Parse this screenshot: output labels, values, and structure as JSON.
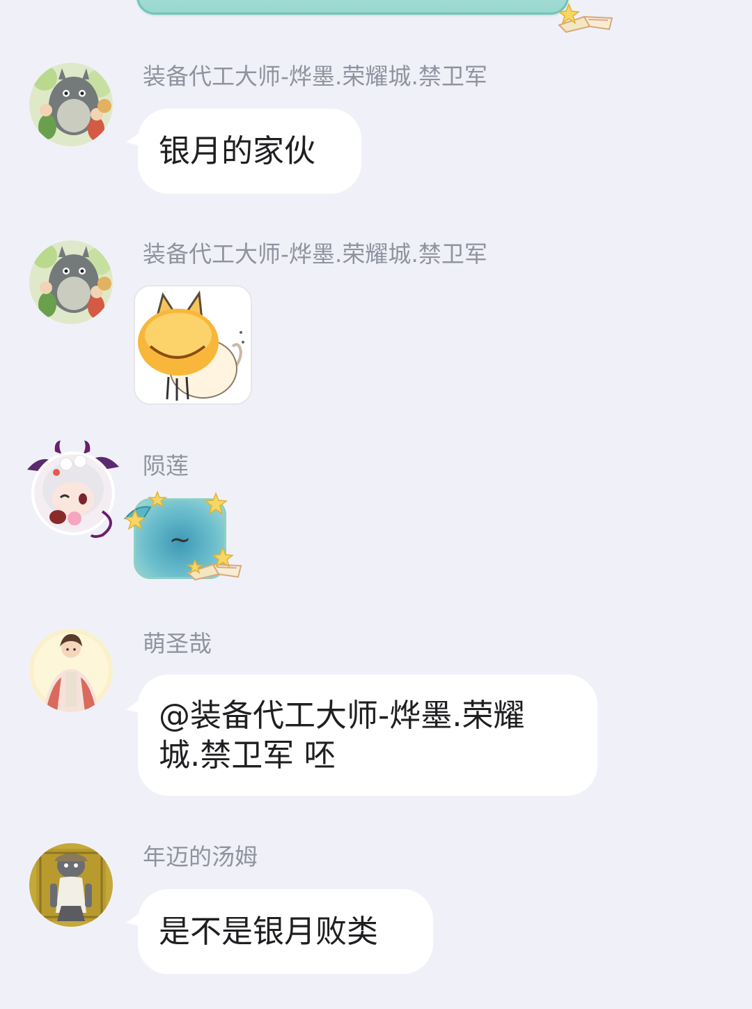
{
  "messages": [
    {
      "sender": "装备代工大师-烨墨.荣耀城.禁卫军",
      "type": "text",
      "text": "银月的家伙",
      "avatar_icon": "totoro-avatar-icon"
    },
    {
      "sender": "装备代工大师-烨墨.荣耀城.禁卫军",
      "type": "sticker",
      "sticker_icon": "yellow-cat-sticker-icon",
      "avatar_icon": "totoro-avatar-icon"
    },
    {
      "sender": "陨莲",
      "type": "text",
      "text": "~",
      "bubble_theme": "teal-star-book",
      "avatar_icon": "demon-wing-anime-avatar-icon"
    },
    {
      "sender": "萌圣哉",
      "type": "text",
      "text_line1": "@装备代工大师-烨墨.荣耀",
      "text_line2": "城.禁卫军 呸",
      "avatar_icon": "anime-hero-avatar-icon"
    },
    {
      "sender": "年迈的汤姆",
      "type": "text",
      "text": "是不是银月败类",
      "avatar_icon": "old-cat-avatar-icon"
    }
  ],
  "colors": {
    "background": "#f0f1f8",
    "bubble": "#ffffff",
    "nickname": "#8f93a0",
    "text": "#1f1f22",
    "theme_teal": "#6fc4b8"
  }
}
